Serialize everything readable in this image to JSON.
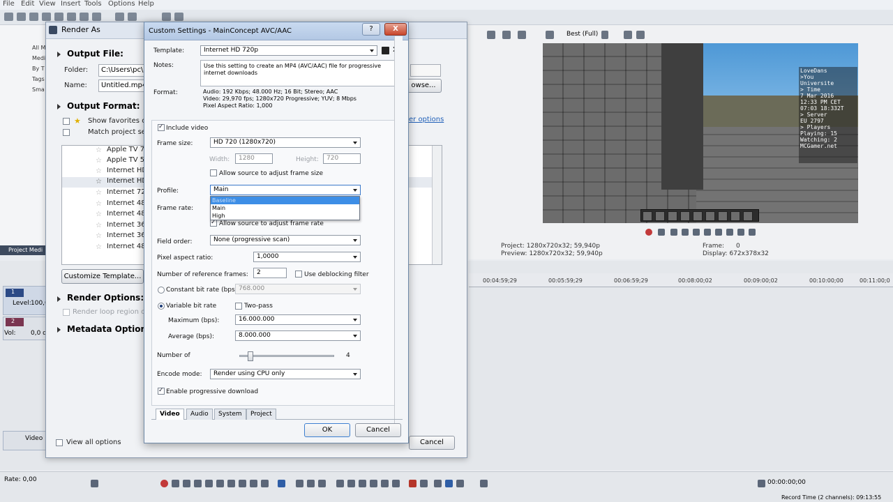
{
  "menu": [
    "File",
    "Edit",
    "View",
    "Insert",
    "Tools",
    "Options",
    "Help"
  ],
  "project_media": {
    "tree": [
      "All M",
      "Medi",
      "By T",
      "Tags",
      "Sma"
    ],
    "label": "Project Medi"
  },
  "preview": {
    "quality": "Best (Full)",
    "project_label": "Project:",
    "project_value": "1280x720x32; 59,940p",
    "preview_label": "Preview:",
    "preview_value": "1280x720x32; 59,940p",
    "frame_label": "Frame:",
    "frame_value": "0",
    "display_label": "Display:",
    "display_value": "672x378x32",
    "hud": "LoveDans\n>You\nUniversite\n> Time\n7 Mar 2016\n12:33 PM CET\n07:03 18:332T\n> Server\nEU 2797\n> Players\nPlaying: 15\nWatching: 2\nMCGamer.net"
  },
  "timeline": {
    "ruler": [
      "00:04:59;29",
      "00:05:59;29",
      "00:06:59;29",
      "00:08:00;02",
      "00:09:00;02",
      "00:10:00;00",
      "00:11:00;0"
    ],
    "track1_num": "1",
    "level_label": "Level:",
    "level_value": "100,0",
    "track2_num": "2",
    "vol_label": "Vol:",
    "vol_value": "0,0 d",
    "video_label": "Video",
    "rate_label": "Rate: 0,00",
    "time_value": "00:00:00;00",
    "record_time": "Record Time (2 channels): 09:13:55"
  },
  "render_as": {
    "title": "Render As",
    "output_file": "Output File:",
    "folder_label": "Folder:",
    "folder_value": "C:\\Users\\pc\\D",
    "name_label": "Name:",
    "name_value": "Untitled.mp4",
    "browse": "owse...",
    "output_format": "Output Format:",
    "show_favorites": "Show favorites on",
    "match_project": "Match project set",
    "more_options": "er options",
    "formats": [
      "Apple TV 72",
      "Apple TV 54",
      "Internet HD",
      "Internet HD",
      "Internet 720",
      "Internet 480",
      "Internet 480",
      "Internet 360",
      "Internet 360",
      "Internet 480"
    ],
    "customize_template": "Customize Template...",
    "render_options": "Render Options:",
    "render_loop": "Render loop region on",
    "metadata_options": "Metadata Options:",
    "view_all_options": "View all options",
    "cancel": "Cancel"
  },
  "custom_settings": {
    "title": "Custom Settings - MainConcept AVC/AAC",
    "help": "?",
    "close": "X",
    "template_label": "Template:",
    "template_value": "Internet HD 720p",
    "notes_label": "Notes:",
    "notes_value": "Use this setting to create an MP4 (AVC/AAC) file for progressive internet downloads",
    "format_label": "Format:",
    "format_audio": "Audio: 192 Kbps; 48.000 Hz; 16 Bit; Stereo; AAC",
    "format_video": "Video: 29,970 fps; 1280x720 Progressive; YUV; 8 Mbps",
    "format_par": "Pixel Aspect Ratio: 1,000",
    "include_video": "Include video",
    "frame_size_label": "Frame size:",
    "frame_size_value": "HD 720 (1280x720)",
    "width_label": "Width:",
    "width_value": "1280",
    "height_label": "Height:",
    "height_value": "720",
    "allow_source_frame_size": "Allow source to adjust frame size",
    "profile_label": "Profile:",
    "profile_value": "Main",
    "profile_options": [
      "Baseline",
      "Main",
      "High"
    ],
    "frame_rate_label": "Frame rate:",
    "allow_source_frame_rate": "Allow source to adjust frame rate",
    "field_order_label": "Field order:",
    "field_order_value": "None (progressive scan)",
    "par_label": "Pixel aspect ratio:",
    "par_value": "1,0000",
    "ref_frames_label": "Number of reference frames:",
    "ref_frames_value": "2",
    "use_deblocking": "Use deblocking filter",
    "cbr_label": "Constant bit rate (bps):",
    "cbr_value": "768.000",
    "vbr_label": "Variable bit rate",
    "two_pass": "Two-pass",
    "max_label": "Maximum (bps):",
    "max_value": "16.000.000",
    "avg_label": "Average (bps):",
    "avg_value": "8.000.000",
    "number_of_label": "Number of",
    "slider_value": "4",
    "slider_fraction": 0.09,
    "encode_mode_label": "Encode mode:",
    "encode_mode_value": "Render using CPU only",
    "progressive_download": "Enable progressive download",
    "tabs": [
      "Video",
      "Audio",
      "System",
      "Project"
    ],
    "ok": "OK",
    "cancel": "Cancel"
  }
}
